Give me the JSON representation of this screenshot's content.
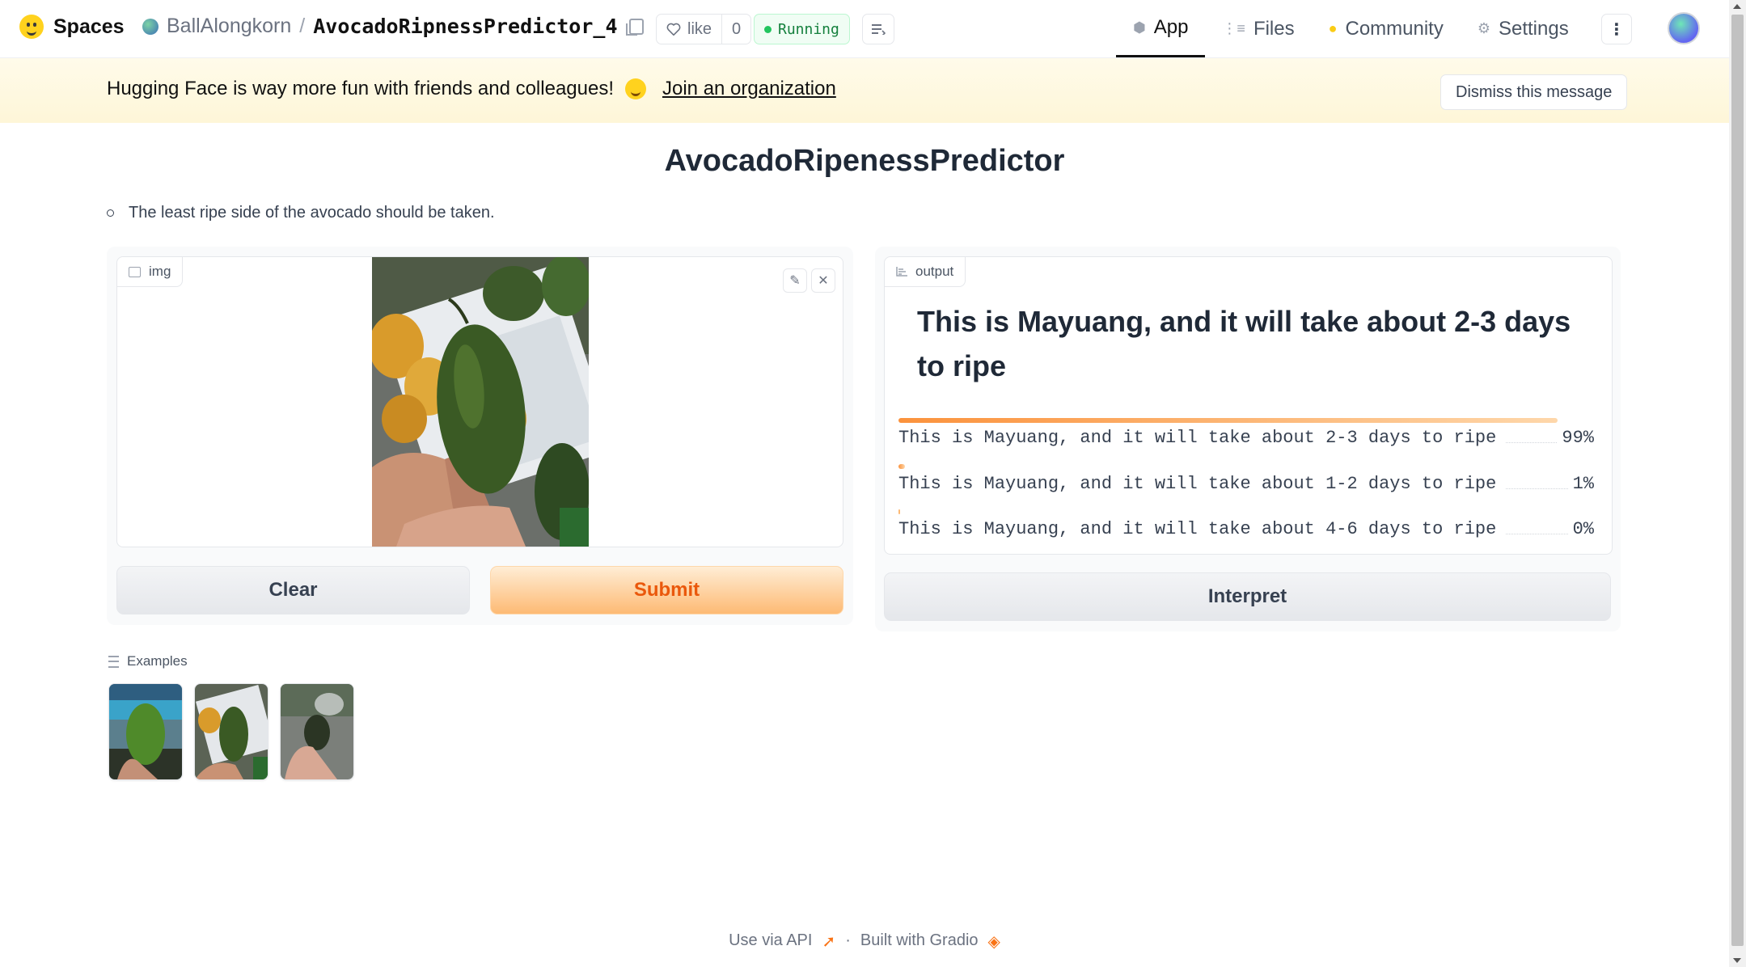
{
  "header": {
    "brand": "Spaces",
    "owner": "BallAlongkorn",
    "separator": "/",
    "repo": "AvocadoRipnessPredictor_4",
    "like_label": "like",
    "like_count": "0",
    "status": "Running",
    "tabs": [
      {
        "label": "App",
        "icon": "cube-icon"
      },
      {
        "label": "Files",
        "icon": "files-icon"
      },
      {
        "label": "Community",
        "icon": "community-icon"
      },
      {
        "label": "Settings",
        "icon": "gear-icon"
      }
    ]
  },
  "banner": {
    "message": "Hugging Face is way more fun with friends and colleagues!",
    "link": "Join an organization",
    "dismiss": "Dismiss this message"
  },
  "app": {
    "title": "AvocadoRipenessPredictor",
    "description": "The least ripe side of the avocado should be taken.",
    "input_label": "img",
    "clear_label": "Clear",
    "submit_label": "Submit",
    "output_label": "output",
    "output_heading": "This is Mayuang, and it will take about 2-3 days to ripe",
    "confidences": [
      {
        "label": "This is Mayuang, and it will take about 2-3 days to ripe",
        "value": 0.99,
        "display": "99%"
      },
      {
        "label": "This is Mayuang, and it will take about 1-2 days to ripe",
        "value": 0.01,
        "display": "1%"
      },
      {
        "label": "This is Mayuang, and it will take about 4-6 days to ripe",
        "value": 0.0,
        "display": "0%"
      }
    ],
    "interpret_label": "Interpret",
    "examples_label": "Examples",
    "example_count": 3
  },
  "footer": {
    "api": "Use via API",
    "dot": "·",
    "built": "Built with Gradio"
  },
  "colors": {
    "accent": "#ea580c",
    "running": "#22c55e",
    "banner": "#fef6d8"
  }
}
